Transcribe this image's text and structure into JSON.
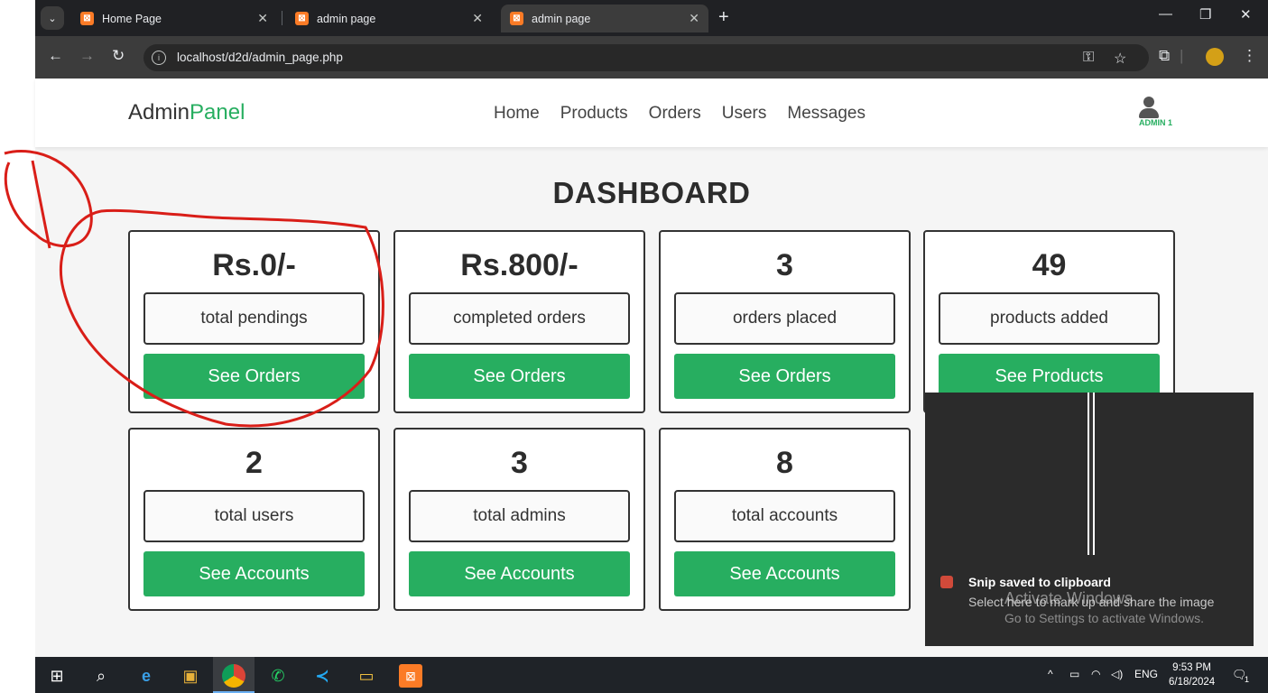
{
  "browser": {
    "tabs": [
      {
        "label": "Home Page",
        "active": false
      },
      {
        "label": "admin page",
        "active": false
      },
      {
        "label": "admin page",
        "active": true
      }
    ],
    "url": "localhost/d2d/admin_page.php"
  },
  "site": {
    "brand_main": "Admin",
    "brand_accent": "Panel",
    "accent_color": "#27ae60",
    "nav": [
      "Home",
      "Products",
      "Orders",
      "Users",
      "Messages"
    ],
    "user_label": "ADMIN 1"
  },
  "dashboard": {
    "title": "DASHBOARD",
    "cards": [
      {
        "value": "Rs.0/-",
        "label": "total pendings",
        "button": "See Orders"
      },
      {
        "value": "Rs.800/-",
        "label": "completed orders",
        "button": "See Orders"
      },
      {
        "value": "3",
        "label": "orders placed",
        "button": "See Orders"
      },
      {
        "value": "49",
        "label": "products added",
        "button": "See Products"
      },
      {
        "value": "2",
        "label": "total users",
        "button": "See Accounts"
      },
      {
        "value": "3",
        "label": "total admins",
        "button": "See Accounts"
      },
      {
        "value": "8",
        "label": "total accounts",
        "button": "See Accounts"
      }
    ]
  },
  "toast": {
    "title": "Snip saved to clipboard",
    "body": "Select here to mark up and share the image"
  },
  "watermark": {
    "line1": "Activate Windows",
    "line2": "Go to Settings to activate Windows."
  },
  "taskbar": {
    "language": "ENG",
    "time": "9:53 PM",
    "date": "6/18/2024",
    "notification_count": "1"
  }
}
